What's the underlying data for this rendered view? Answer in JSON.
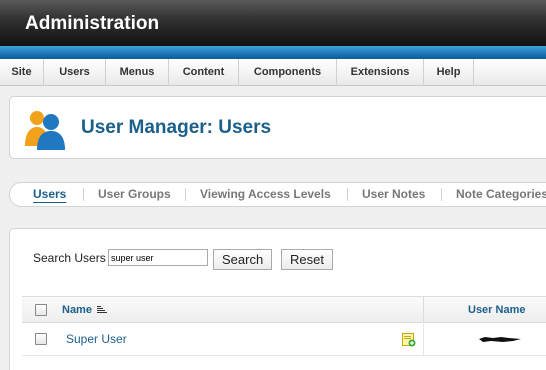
{
  "header": {
    "title": "Administration"
  },
  "menu": {
    "items": [
      {
        "label": "Site"
      },
      {
        "label": "Users"
      },
      {
        "label": "Menus"
      },
      {
        "label": "Content"
      },
      {
        "label": "Components"
      },
      {
        "label": "Extensions"
      },
      {
        "label": "Help"
      }
    ]
  },
  "page": {
    "title": "User Manager: Users"
  },
  "subtabs": {
    "items": [
      {
        "label": "Users",
        "active": true
      },
      {
        "label": "User Groups"
      },
      {
        "label": "Viewing Access Levels"
      },
      {
        "label": "User Notes"
      },
      {
        "label": "Note Categories"
      }
    ]
  },
  "search": {
    "label": "Search Users",
    "value": "super user",
    "search_button": "Search",
    "reset_button": "Reset"
  },
  "table": {
    "columns": {
      "name": "Name",
      "username": "User Name"
    },
    "rows": [
      {
        "name": "Super User"
      }
    ]
  },
  "icons": {
    "title": "users-icon",
    "sort": "sort-icon",
    "note": "add-note-icon"
  },
  "colors": {
    "brand_blue": "#1b75b8",
    "link_blue": "#1b5f8a",
    "header_dark": "#111111"
  }
}
